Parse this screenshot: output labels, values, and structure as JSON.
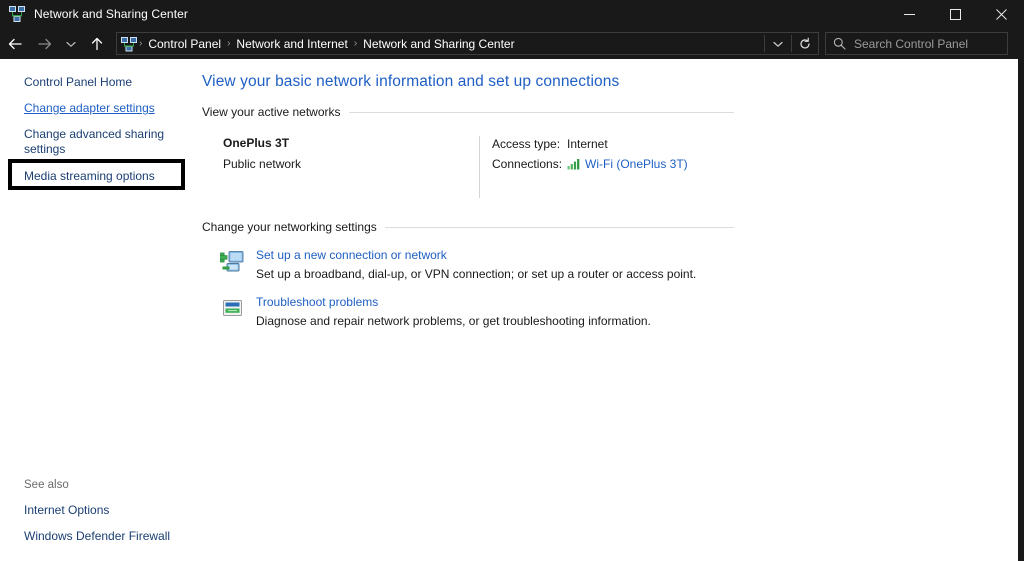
{
  "window": {
    "title": "Network and Sharing Center",
    "icon": "network-sharing-icon",
    "minimize_label": "Minimize",
    "maximize_label": "Maximize",
    "close_label": "Close"
  },
  "nav": {
    "back_label": "Back",
    "forward_label": "Forward",
    "recent_label": "Recent locations",
    "up_label": "Up",
    "refresh_label": "Refresh",
    "dropdown_label": "Previous locations",
    "breadcrumbs": [
      {
        "label": "Control Panel"
      },
      {
        "label": "Network and Internet"
      },
      {
        "label": "Network and Sharing Center"
      }
    ],
    "separator": "›"
  },
  "search": {
    "placeholder": "Search Control Panel",
    "value": "",
    "icon": "search-icon"
  },
  "sidebar": {
    "items": [
      {
        "label": "Control Panel Home",
        "highlighted": false
      },
      {
        "label": "Change adapter settings",
        "highlighted": true
      },
      {
        "label": "Change advanced sharing settings",
        "highlighted": false
      },
      {
        "label": "Media streaming options",
        "highlighted": false
      }
    ],
    "see_also": {
      "title": "See also",
      "links": [
        {
          "label": "Internet Options"
        },
        {
          "label": "Windows Defender Firewall"
        }
      ]
    }
  },
  "main": {
    "page_title": "View your basic network information and set up connections",
    "active_networks": {
      "heading": "View your active networks",
      "network_name": "OnePlus 3T",
      "network_type": "Public network",
      "access_type_label": "Access type:",
      "access_type_value": "Internet",
      "connections_label": "Connections:",
      "connections_value": "Wi-Fi (OnePlus 3T)",
      "connections_icon": "wifi-signal-icon"
    },
    "networking_settings": {
      "heading": "Change your networking settings",
      "items": [
        {
          "icon": "new-connection-icon",
          "title": "Set up a new connection or network",
          "description": "Set up a broadband, dial-up, or VPN connection; or set up a router or access point."
        },
        {
          "icon": "troubleshoot-icon",
          "title": "Troubleshoot problems",
          "description": "Diagnose and repair network problems, or get troubleshooting information."
        }
      ]
    }
  },
  "colors": {
    "titlebar_bg": "#191919",
    "link_blue": "#1f5fc4",
    "sidebar_link": "#1b3f73",
    "callout_border": "#000000",
    "wifi_green": "#3aa545"
  }
}
